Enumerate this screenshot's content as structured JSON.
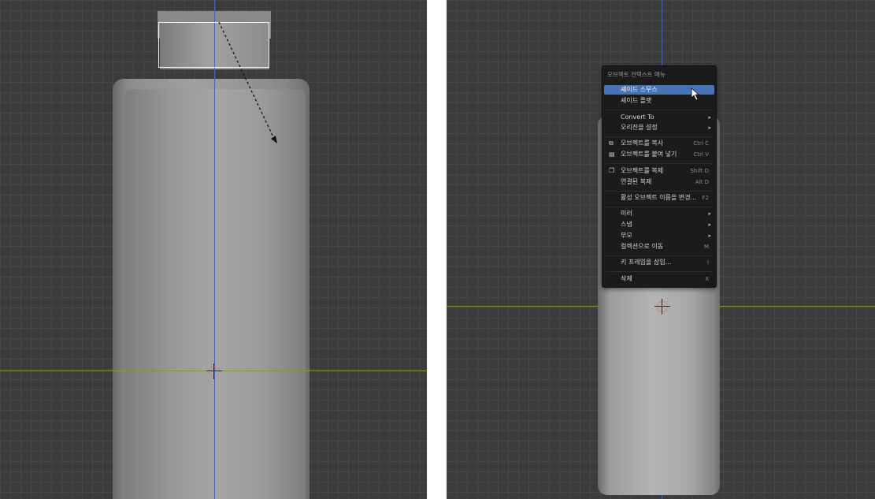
{
  "menu": {
    "title": "오브젝트 컨텍스트 메뉴",
    "items": [
      {
        "label": "셰이드 스무스",
        "shortcut": "",
        "icon": "",
        "submenu": false,
        "active": true
      },
      {
        "label": "셰이드 플랫",
        "shortcut": "",
        "icon": "",
        "submenu": false,
        "active": false
      },
      {
        "label": "Convert To",
        "shortcut": "",
        "icon": "",
        "submenu": true,
        "active": false
      },
      {
        "label": "오리진을 설정",
        "shortcut": "",
        "icon": "",
        "submenu": true,
        "active": false
      },
      {
        "label": "오브젝트를 복사",
        "shortcut": "Ctrl C",
        "icon": "copy-icon",
        "submenu": false,
        "active": false
      },
      {
        "label": "오브젝트를 붙여 넣기",
        "shortcut": "Ctrl V",
        "icon": "paste-icon",
        "submenu": false,
        "active": false
      },
      {
        "label": "오브젝트를 복제",
        "shortcut": "Shift D",
        "icon": "duplicate-icon",
        "submenu": false,
        "active": false
      },
      {
        "label": "연결된 복제",
        "shortcut": "Alt D",
        "icon": "",
        "submenu": false,
        "active": false
      },
      {
        "label": "활성 오브젝트 이름을 변경...",
        "shortcut": "F2",
        "icon": "",
        "submenu": false,
        "active": false
      },
      {
        "label": "미러",
        "shortcut": "",
        "icon": "",
        "submenu": true,
        "active": false
      },
      {
        "label": "스냅",
        "shortcut": "",
        "icon": "",
        "submenu": true,
        "active": false
      },
      {
        "label": "부모",
        "shortcut": "",
        "icon": "",
        "submenu": true,
        "active": false
      },
      {
        "label": "컬렉션으로 이동",
        "shortcut": "M",
        "icon": "",
        "submenu": false,
        "active": false
      },
      {
        "label": "키 프레임을 삽입...",
        "shortcut": "I",
        "icon": "",
        "submenu": false,
        "active": false
      },
      {
        "label": "삭제",
        "shortcut": "X",
        "icon": "",
        "submenu": false,
        "active": false
      }
    ]
  },
  "colors": {
    "viewport_bg": "#3c3c3c",
    "menu_bg": "#1b1b1b",
    "highlight": "#4772b3",
    "axis_y": "#4a63b8",
    "axis_x": "#7a9a3c"
  }
}
